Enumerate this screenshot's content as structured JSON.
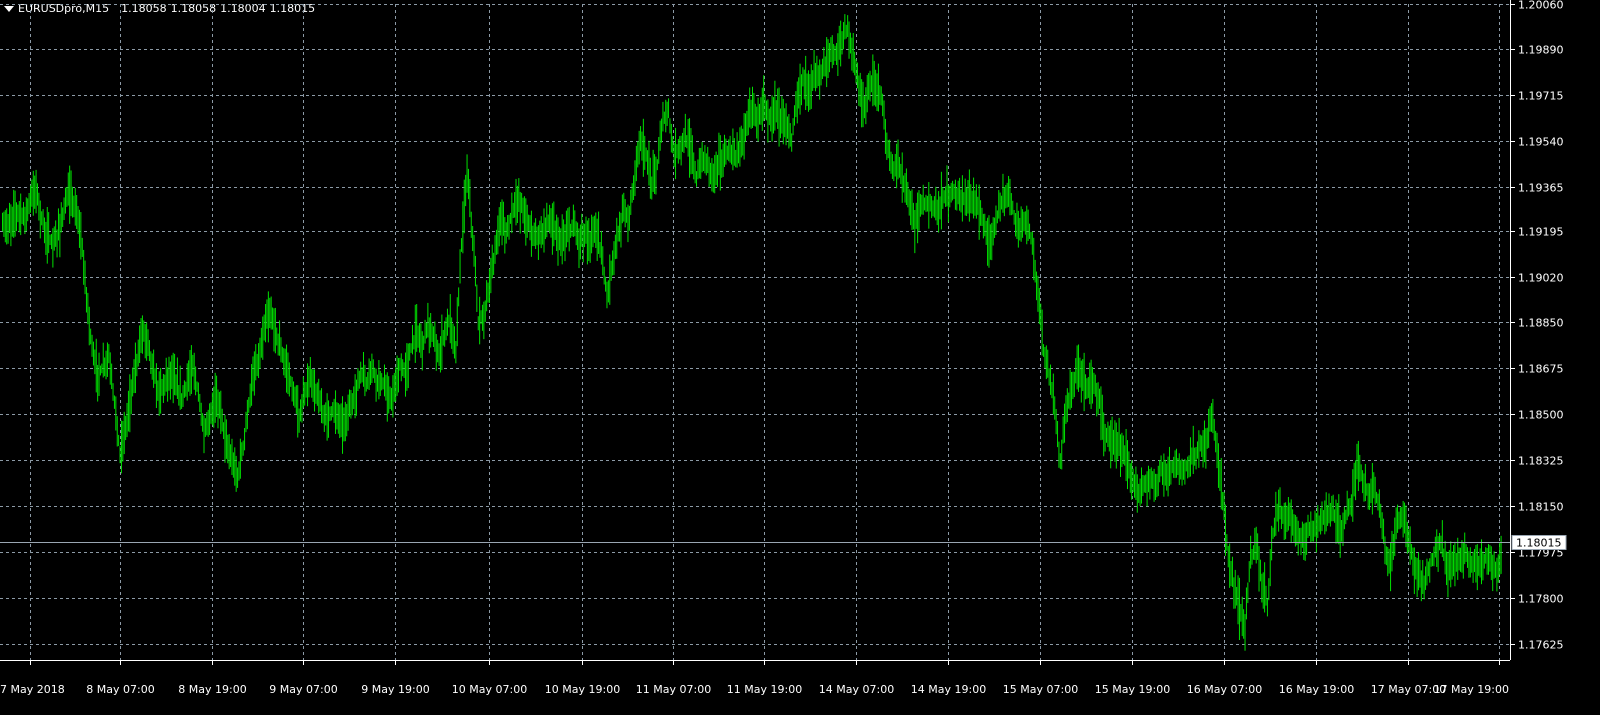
{
  "header": {
    "symbol": "EURUSDpro,M15",
    "open": "1.18058",
    "high": "1.18058",
    "low": "1.18004",
    "close": "1.18015"
  },
  "colors": {
    "background": "#000000",
    "candle": "#00e000",
    "grid": "#8c9aa6",
    "axis": "#ffffff",
    "current_price_line": "#9aa6b2"
  },
  "chart_data": {
    "type": "line",
    "instrument": "EURUSDpro",
    "timeframe": "M15",
    "ylim": [
      1.17565,
      1.2006
    ],
    "y_ticks": [
      1.2006,
      1.1989,
      1.19715,
      1.1954,
      1.19365,
      1.19195,
      1.1902,
      1.1885,
      1.18675,
      1.185,
      1.18325,
      1.1815,
      1.17975,
      1.178,
      1.17625
    ],
    "y_tick_labels": [
      "1.20060",
      "1.19890",
      "1.19715",
      "1.19540",
      "1.19365",
      "1.19195",
      "1.19020",
      "1.18850",
      "1.18675",
      "1.18500",
      "1.18325",
      "1.18150",
      "1.17975",
      "1.17800",
      "1.17625"
    ],
    "x_tick_labels": [
      "7 May 2018",
      "8 May 07:00",
      "8 May 19:00",
      "9 May 07:00",
      "9 May 19:00",
      "10 May 07:00",
      "10 May 19:00",
      "11 May 07:00",
      "11 May 19:00",
      "14 May 07:00",
      "14 May 19:00",
      "15 May 07:00",
      "15 May 19:00",
      "16 May 07:00",
      "16 May 19:00",
      "17 May 07:00",
      "17 May 19:00"
    ],
    "current_price": 1.18015,
    "current_price_label": "1.18015",
    "grid": true,
    "series": [
      {
        "values": [
          1.1922,
          1.1921,
          1.1926,
          1.1927,
          1.1925,
          1.1932,
          1.1936,
          1.1924,
          1.1918,
          1.1914,
          1.1919,
          1.1928,
          1.1934,
          1.1928,
          1.1918,
          1.1895,
          1.1875,
          1.1865,
          1.1868,
          1.1872,
          1.1855,
          1.1835,
          1.1845,
          1.1858,
          1.187,
          1.1882,
          1.1878,
          1.1865,
          1.1858,
          1.1862,
          1.1866,
          1.1861,
          1.1856,
          1.1862,
          1.1868,
          1.1858,
          1.1842,
          1.1848,
          1.1856,
          1.1852,
          1.1838,
          1.1832,
          1.1826,
          1.1838,
          1.1854,
          1.1866,
          1.1872,
          1.1885,
          1.1888,
          1.188,
          1.1872,
          1.1866,
          1.1858,
          1.1848,
          1.1858,
          1.1864,
          1.1858,
          1.1852,
          1.1849,
          1.1852,
          1.1849,
          1.1846,
          1.1852,
          1.1857,
          1.1866,
          1.1862,
          1.1868,
          1.1863,
          1.1862,
          1.1855,
          1.1858,
          1.1868,
          1.1866,
          1.1875,
          1.1882,
          1.1876,
          1.1885,
          1.1878,
          1.1872,
          1.1882,
          1.1886,
          1.1874,
          1.1915,
          1.1942,
          1.1918,
          1.1885,
          1.1888,
          1.1898,
          1.1912,
          1.1925,
          1.1918,
          1.1927,
          1.1932,
          1.1928,
          1.1922,
          1.1918,
          1.1918,
          1.1922,
          1.1923,
          1.1918,
          1.1915,
          1.1919,
          1.1922,
          1.1916,
          1.1919,
          1.1915,
          1.1922,
          1.191,
          1.1896,
          1.1908,
          1.1918,
          1.1928,
          1.1925,
          1.1942,
          1.1955,
          1.1948,
          1.1938,
          1.1945,
          1.1962,
          1.1965,
          1.1948,
          1.1952,
          1.1955,
          1.195,
          1.194,
          1.1947,
          1.1945,
          1.1942,
          1.1946,
          1.1948,
          1.195,
          1.1948,
          1.1952,
          1.1962,
          1.1966,
          1.1962,
          1.1968,
          1.1962,
          1.1966,
          1.1962,
          1.1962,
          1.1955,
          1.1972,
          1.1977,
          1.1975,
          1.1978,
          1.1978,
          1.1983,
          1.1988,
          1.1986,
          1.1993,
          1.1997,
          1.1986,
          1.1975,
          1.1965,
          1.1975,
          1.1975,
          1.1972,
          1.1952,
          1.1942,
          1.1945,
          1.1938,
          1.1932,
          1.1922,
          1.193,
          1.193,
          1.193,
          1.1928,
          1.1932,
          1.1933,
          1.1935,
          1.1932,
          1.1933,
          1.1932,
          1.193,
          1.1924,
          1.1918,
          1.1918,
          1.1928,
          1.1932,
          1.1935,
          1.1922,
          1.1922,
          1.1925,
          1.1915,
          1.1895,
          1.1875,
          1.1865,
          1.1852,
          1.1832,
          1.1852,
          1.1858,
          1.1868,
          1.1863,
          1.1861,
          1.1862,
          1.1854,
          1.1842,
          1.184,
          1.1839,
          1.1836,
          1.1832,
          1.1825,
          1.182,
          1.1822,
          1.1825,
          1.1822,
          1.1829,
          1.1826,
          1.183,
          1.183,
          1.1828,
          1.1832,
          1.1834,
          1.1838,
          1.1837,
          1.185,
          1.1838,
          1.1818,
          1.1795,
          1.1785,
          1.1776,
          1.177,
          1.1795,
          1.1802,
          1.1786,
          1.1778,
          1.1805,
          1.1815,
          1.181,
          1.1812,
          1.1804,
          1.1802,
          1.1806,
          1.1807,
          1.1808,
          1.181,
          1.1814,
          1.1812,
          1.1806,
          1.1812,
          1.1815,
          1.1832,
          1.1825,
          1.182,
          1.1822,
          1.1815,
          1.18,
          1.1792,
          1.1808,
          1.1812,
          1.1805,
          1.1795,
          1.1788,
          1.1785,
          1.1792,
          1.1798,
          1.1802,
          1.1792,
          1.1793,
          1.1795,
          1.1798,
          1.1794,
          1.1792,
          1.1793,
          1.1795,
          1.1794,
          1.179,
          1.1802
        ]
      }
    ]
  }
}
